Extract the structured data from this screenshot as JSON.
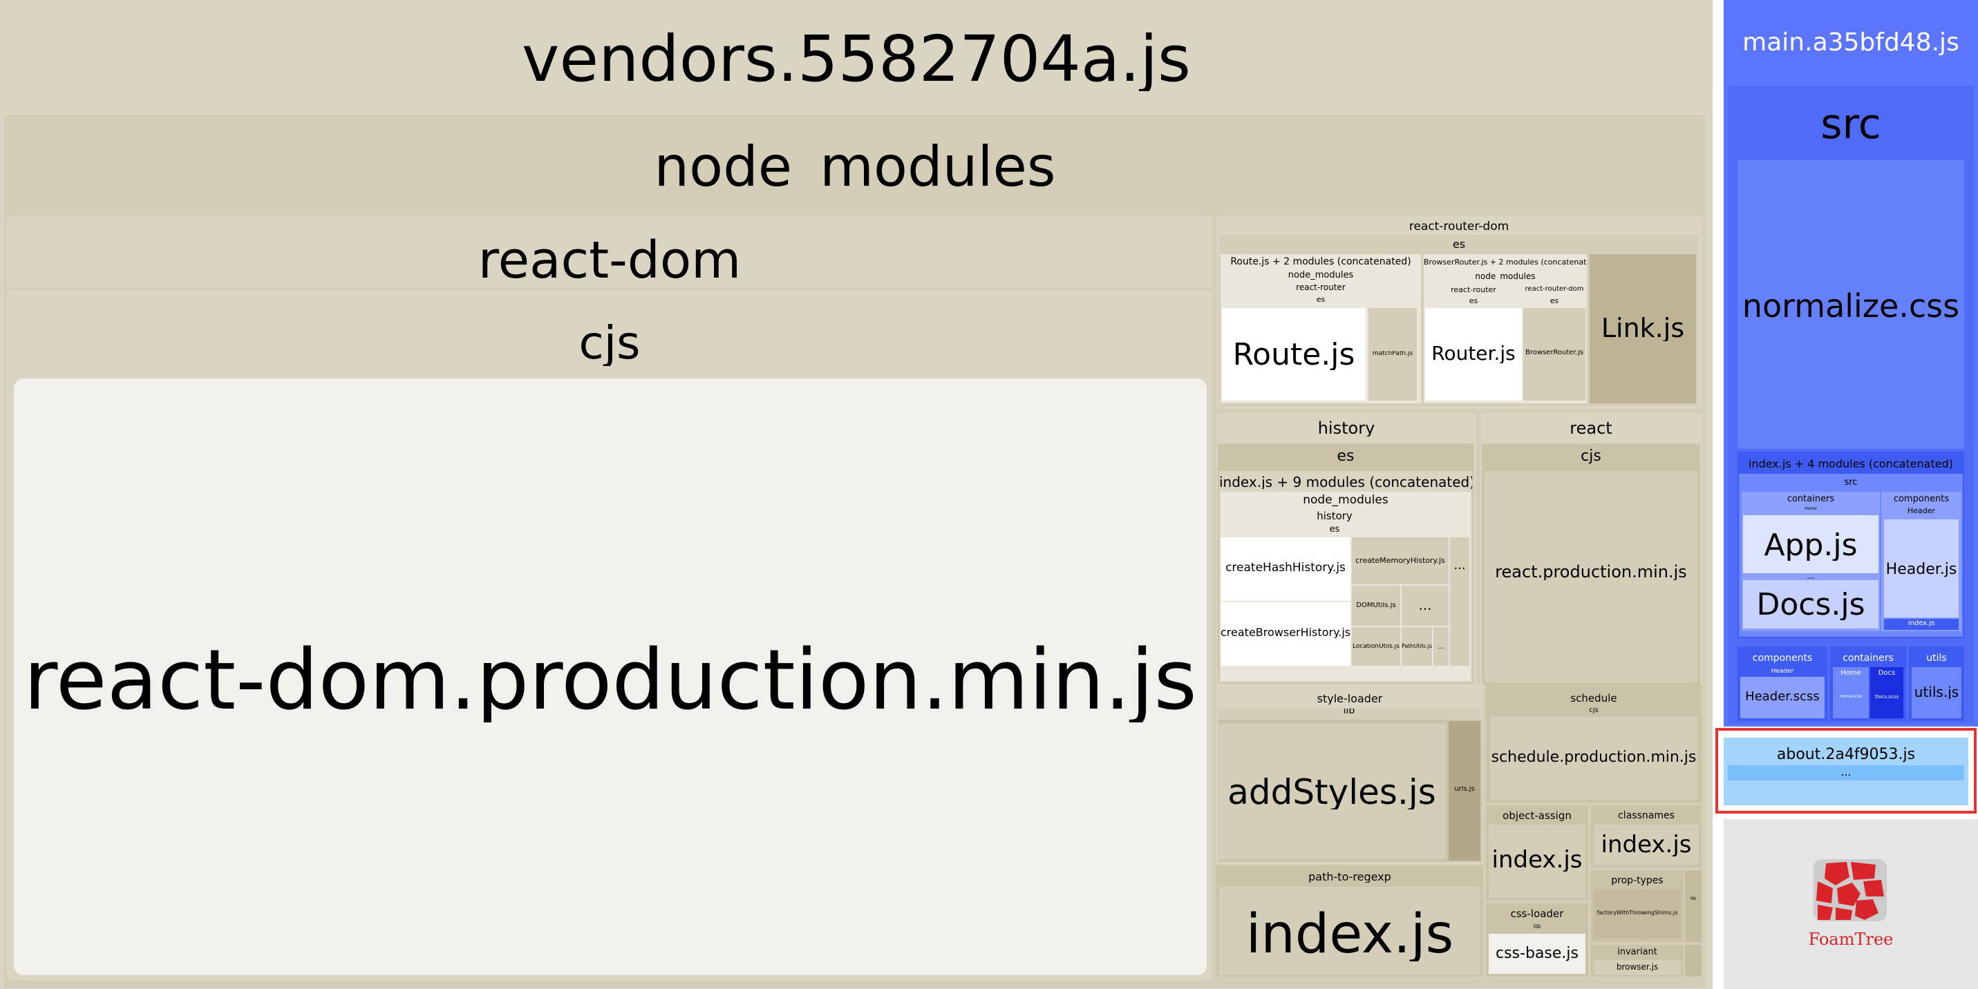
{
  "vendors": {
    "title": "vendors.5582704a.js",
    "node_modules": "node_modules",
    "react_dom": {
      "label": "react-dom",
      "cjs": "cjs",
      "file": "react-dom.production.min.js"
    },
    "react_router_dom": {
      "label": "react-router-dom",
      "es": "es",
      "route_group": {
        "label": "Route.js + 2 modules (concatenated)",
        "node_modules": "node_modules",
        "react_router": "react-router",
        "es": "es",
        "route": "Route.js",
        "match_path": "matchPath.js"
      },
      "browser_router_group": {
        "label": "BrowserRouter.js + 2 modules (concatenated)",
        "node_modules": "node_modules",
        "react_router": "react-router",
        "react_router_dom": "react-router-dom",
        "es": "es",
        "es2": "es",
        "router": "Router.js",
        "browser_router": "BrowserRouter.js"
      },
      "link": "Link.js"
    },
    "history": {
      "label": "history",
      "es": "es",
      "concat": "index.js + 9 modules (concatenated)",
      "node_modules": "node_modules",
      "history": "history",
      "es2": "es",
      "create_hash": "createHashHistory.js",
      "create_browser": "createBrowserHistory.js",
      "create_memory": "createMemoryHistory.js",
      "dom_utils": "DOMUtils.js",
      "location_utils": "LocationUtils.js",
      "path_utils": "PathUtils.js",
      "more": "..."
    },
    "react": {
      "label": "react",
      "cjs": "cjs",
      "file": "react.production.min.js"
    },
    "style_loader": {
      "label": "style-loader",
      "lib": "lib",
      "add_styles": "addStyles.js",
      "urls": "urls.js"
    },
    "schedule": {
      "label": "schedule",
      "cjs": "cjs",
      "file": "schedule.production.min.js"
    },
    "object_assign": {
      "label": "object-assign",
      "file": "index.js"
    },
    "classnames": {
      "label": "classnames",
      "file": "index.js"
    },
    "prop_types": {
      "label": "prop-types",
      "file": "factoryWithThrowingShims.js",
      "lib": "lib"
    },
    "path_to_regexp": {
      "label": "path-to-regexp",
      "file": "index.js"
    },
    "css_loader": {
      "label": "css-loader",
      "lib": "lib",
      "file": "css-base.js"
    },
    "invariant": {
      "label": "invariant",
      "file": "browser.js"
    }
  },
  "main": {
    "title": "main.a35bfd48.js",
    "src": "src",
    "normalize": "normalize.css",
    "concat": {
      "label": "index.js + 4 modules (concatenated)",
      "src": "src",
      "containers": "containers",
      "components": "components",
      "header": "Header",
      "app": "App.js",
      "docs": "Docs.js",
      "header_js": "Header.js",
      "index": "index.js",
      "more": "...",
      "home_small": "Home"
    },
    "bottom": {
      "components": "components",
      "header": "Header",
      "header_scss": "Header.scss",
      "containers": "containers",
      "home": "Home",
      "docs": "Docs",
      "home_scss": "Home.scss",
      "docs_scss": "Docs.scss",
      "utils": "utils",
      "utils_js": "utils.js"
    }
  },
  "about": {
    "title": "about.2a4f9053.js",
    "more": "..."
  },
  "logo": {
    "text": "FoamTree"
  },
  "colors": {
    "vendor": "#dad5c3",
    "main": "#5b76fc",
    "about": "#a4d4fc",
    "selection": "#e53333"
  }
}
